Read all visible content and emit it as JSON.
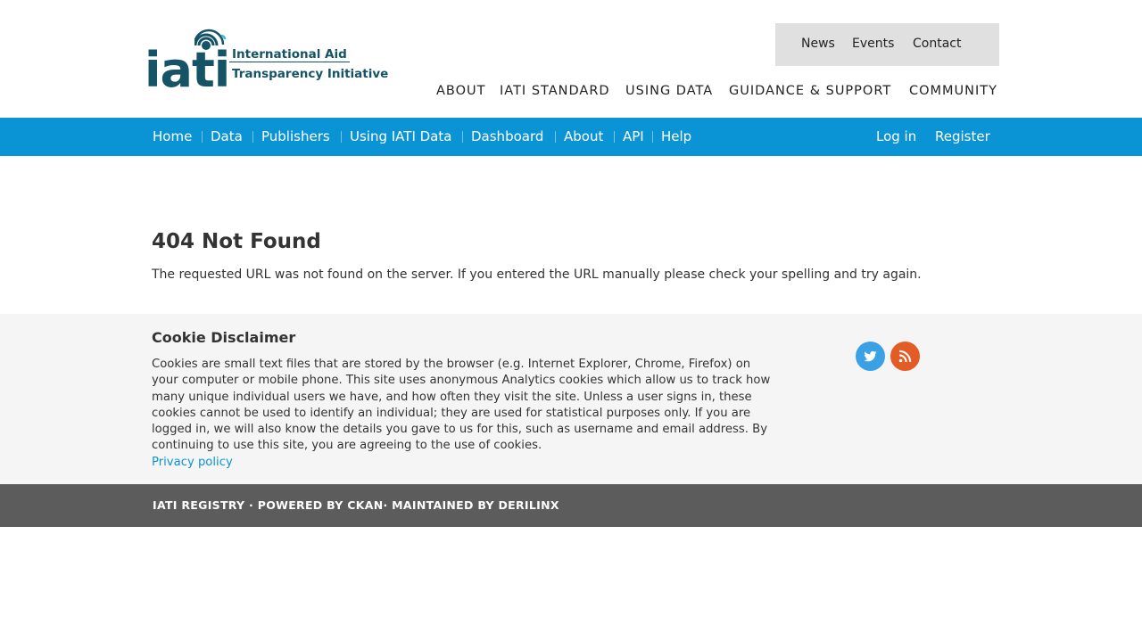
{
  "header": {
    "logo": {
      "wordmark": "iati",
      "line1": "International Aid",
      "line2": "Transparency Initiative",
      "icon": "signal-broadcast-icon",
      "color": "#155366"
    },
    "utility_links": [
      "News",
      "Events",
      "Contact"
    ],
    "main_nav": [
      "ABOUT",
      "IATI STANDARD",
      "USING DATA",
      "GUIDANCE & SUPPORT",
      "COMMUNITY"
    ]
  },
  "blue_nav": {
    "color": "#0a94d6",
    "items": [
      "Home",
      "Data",
      "Publishers",
      "Using IATI Data",
      "Dashboard",
      "About",
      "API",
      "Help"
    ],
    "login": "Log in",
    "register": "Register"
  },
  "content": {
    "title": "404 Not Found",
    "message": "The requested URL was not found on the server. If you entered the URL manually please check your spelling and try again."
  },
  "footer": {
    "cookie_title": "Cookie Disclaimer",
    "cookie_text": "Cookies are small text files that are stored by the browser (e.g. Internet Explorer, Chrome, Firefox) on your computer or mobile phone. This site uses anonymous Analytics cookies which allow us to track how many unique individual users we have, and how often they visit the site. Unless a user signs in, these cookies cannot be used to identify an individual; they are used for statistical purposes only. If you are logged in, we will also know the details you gave to us for this, such as username and email address. By continuing to use this site, you are agreeing to the use of cookies.",
    "privacy_link": "Privacy policy",
    "social_icons": [
      "twitter-icon",
      "rss-icon"
    ],
    "bottom_text": "IATI REGISTRY · POWERED BY CKAN· MAINTAINED BY DERILINX"
  }
}
